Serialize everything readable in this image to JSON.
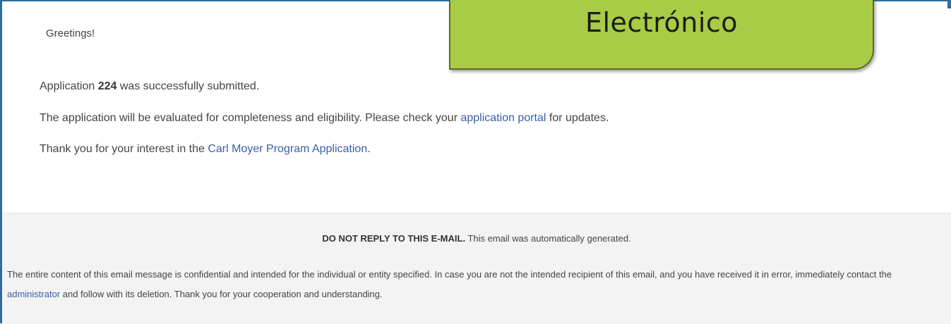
{
  "email": {
    "greeting": "Greetings!",
    "submitted": {
      "prefix": "Application ",
      "number": "224",
      "suffix": " was successfully submitted."
    },
    "evaluation": {
      "prefix": "The application will be evaluated for completeness and eligibility. Please check your ",
      "link": "application portal",
      "suffix": " for updates."
    },
    "thanks": {
      "prefix": "Thank you for your interest in the ",
      "link": "Carl Moyer Program Application",
      "suffix": "."
    }
  },
  "footer": {
    "warning_bold": "DO NOT REPLY TO THIS E-MAIL.",
    "warning_rest": " This email was automatically generated.",
    "legal": {
      "prefix": "The entire content of this email message is confidential and intended for the individual or entity specified. In case you are not the intended recipient of this email, and you have received it in error, immediately contact the ",
      "link": "administrator",
      "suffix": " and follow with its deletion. Thank you for your cooperation and understanding."
    }
  },
  "callout": {
    "text": "Electrónico"
  },
  "colors": {
    "link": "#3b5fa8",
    "callout_fill": "#a8cc45",
    "frame": "#2e6e9e",
    "footer_bg": "#f3f3f3"
  }
}
